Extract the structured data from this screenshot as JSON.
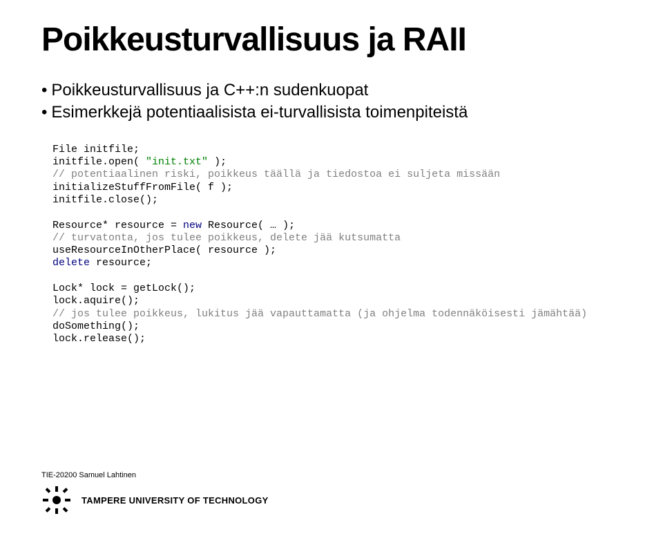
{
  "title": "Poikkeusturvallisuus ja RAII",
  "bullets": {
    "b1": "Poikkeusturvallisuus ja C++:n sudenkuopat",
    "b2": "Esimerkkejä potentiaalisista ei-turvallisista toimenpiteistä"
  },
  "code": {
    "l1": "File initfile;",
    "l2a": "initfile.open( ",
    "l2b": "\"init.txt\" ",
    "l2c": ");",
    "l3": "// potentiaalinen riski, poikkeus täällä ja tiedostoa ei suljeta missään",
    "l4": "initializeStuffFromFile( f );",
    "l5": "initfile.close();",
    "l6a": "Resource* resource = ",
    "l6b": "new ",
    "l6c": "Resource( … );",
    "l7": "// turvatonta, jos tulee poikkeus, delete jää kutsumatta",
    "l8": "useResourceInOtherPlace( resource );",
    "l9a": "delete ",
    "l9b": "resource;",
    "l10": "Lock* lock = getLock();",
    "l11": "lock.aquire();",
    "l12": "// jos tulee poikkeus, lukitus jää vapauttamatta (ja ohjelma todennäköisesti jämähtää)",
    "l13": "doSomething();",
    "l14": "lock.release();"
  },
  "footer": {
    "course": "TIE-20200 Samuel Lahtinen",
    "university": "TAMPERE UNIVERSITY OF TECHNOLOGY"
  }
}
